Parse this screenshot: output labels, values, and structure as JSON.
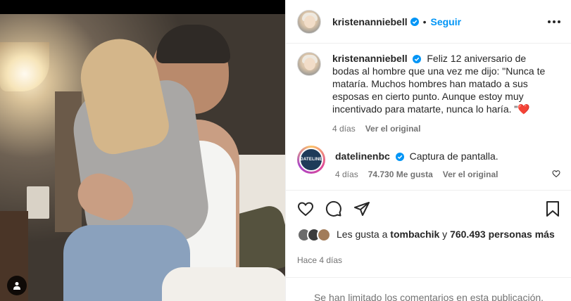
{
  "post": {
    "username": "kristenanniebell",
    "follow_label": "Seguir",
    "dot": "•"
  },
  "caption": {
    "username": "kristenanniebell",
    "text": "Feliz 12 aniversario de bodas al hombre que una vez me dijo: \"Nunca te mataría. Muchos hombres han matado a sus esposas en cierto punto. Aunque estoy muy incentivado para matarte, nunca lo haría. \"",
    "emoji": "❤️",
    "age": "4 días",
    "see_original": "Ver el original"
  },
  "comment": {
    "username": "datelinenbc",
    "avatar_text": "DATELINE",
    "text": "Captura de pantalla.",
    "age": "4 días",
    "likes": "74.730 Me gusta",
    "see_original": "Ver el original"
  },
  "likes": {
    "prefix": "Les gusta a ",
    "user": "tombachik",
    "middle": " y ",
    "count": "760.493 personas más"
  },
  "timestamp": "Hace 4 días",
  "limited_notice": "Se han limitado los comentarios en esta publicación.",
  "colors": {
    "accent": "#0095f6",
    "verified": "#0095f6",
    "heart": "#ed4956"
  },
  "icons": {
    "like": "heart-icon",
    "comment": "comment-icon",
    "share": "share-icon",
    "save": "bookmark-icon",
    "more": "more-icon"
  }
}
